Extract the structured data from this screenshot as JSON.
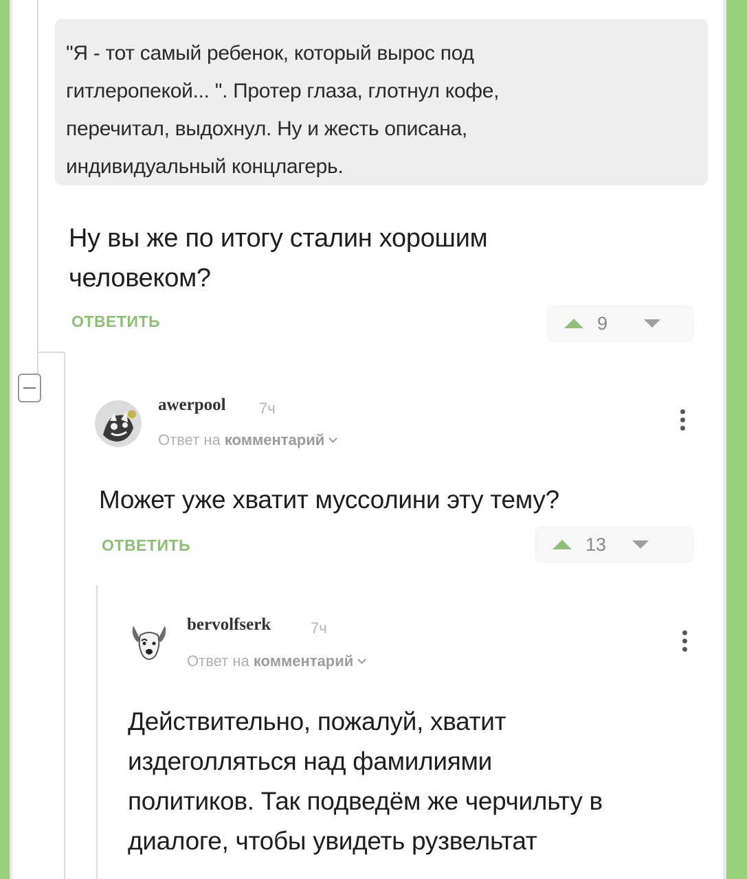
{
  "quote": {
    "text": "\"Я - тот самый ребенок, который вырос под\nгитлеропекой... \". Протер глаза, глотнул кофе,\nперечитал, выдохнул. Ну и жесть описана,\nиндивидуальный концлагерь."
  },
  "comments": [
    {
      "text": "Ну вы же по итогу сталин хорошим\nчеловеком?",
      "reply_label": "ОТВЕТИТЬ",
      "rating": "9"
    },
    {
      "username": "awerpool",
      "time": "7ч",
      "reply_to_prefix": "Ответ на",
      "reply_to_link": "комментарий",
      "text": "Может уже хватит муссолини эту тему?",
      "reply_label": "ОТВЕТИТЬ",
      "rating": "13"
    },
    {
      "username": "bervolfserk",
      "time": "7ч",
      "reply_to_prefix": "Ответ на",
      "reply_to_link": "комментарий",
      "text": "Действительно, пожалуй, хватит\nиздеголляться над фамилиями\nполитиков. Так подведём же черчильту в\nдиалоге, чтобы увидеть рузвельтат"
    }
  ],
  "icons": {
    "upvote": "triangle-up-icon",
    "downvote": "triangle-down-icon",
    "menu": "three-dots-vertical-icon",
    "collapse": "minus-box-icon"
  },
  "colors": {
    "accent_green": "#8dbf76",
    "side_green": "#98cf7a",
    "quote_bg": "#eeeeee"
  }
}
